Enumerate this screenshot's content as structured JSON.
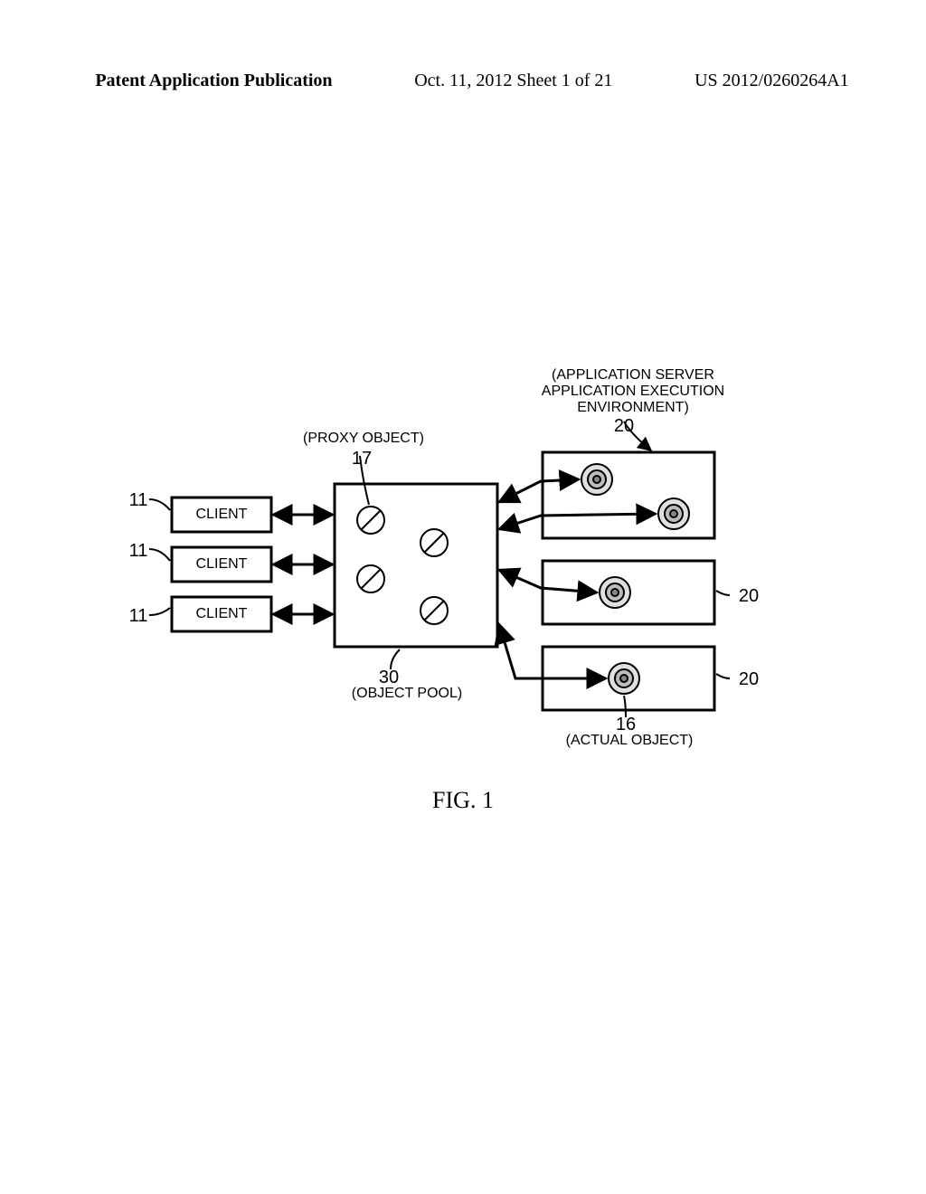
{
  "header": {
    "left": "Patent Application Publication",
    "mid": "Oct. 11, 2012  Sheet 1 of 21",
    "right": "US 2012/0260264A1"
  },
  "figure_caption": "FIG. 1",
  "labels": {
    "app_server_l1": "(APPLICATION SERVER",
    "app_server_l2": "APPLICATION EXECUTION",
    "app_server_l3": "ENVIRONMENT)",
    "proxy_object": "(PROXY OBJECT)",
    "object_pool": "(OBJECT POOL)",
    "actual_object": "(ACTUAL OBJECT)",
    "n11": "11",
    "n17": "17",
    "n20": "20",
    "n30": "30",
    "n16": "16",
    "client": "CLIENT"
  }
}
